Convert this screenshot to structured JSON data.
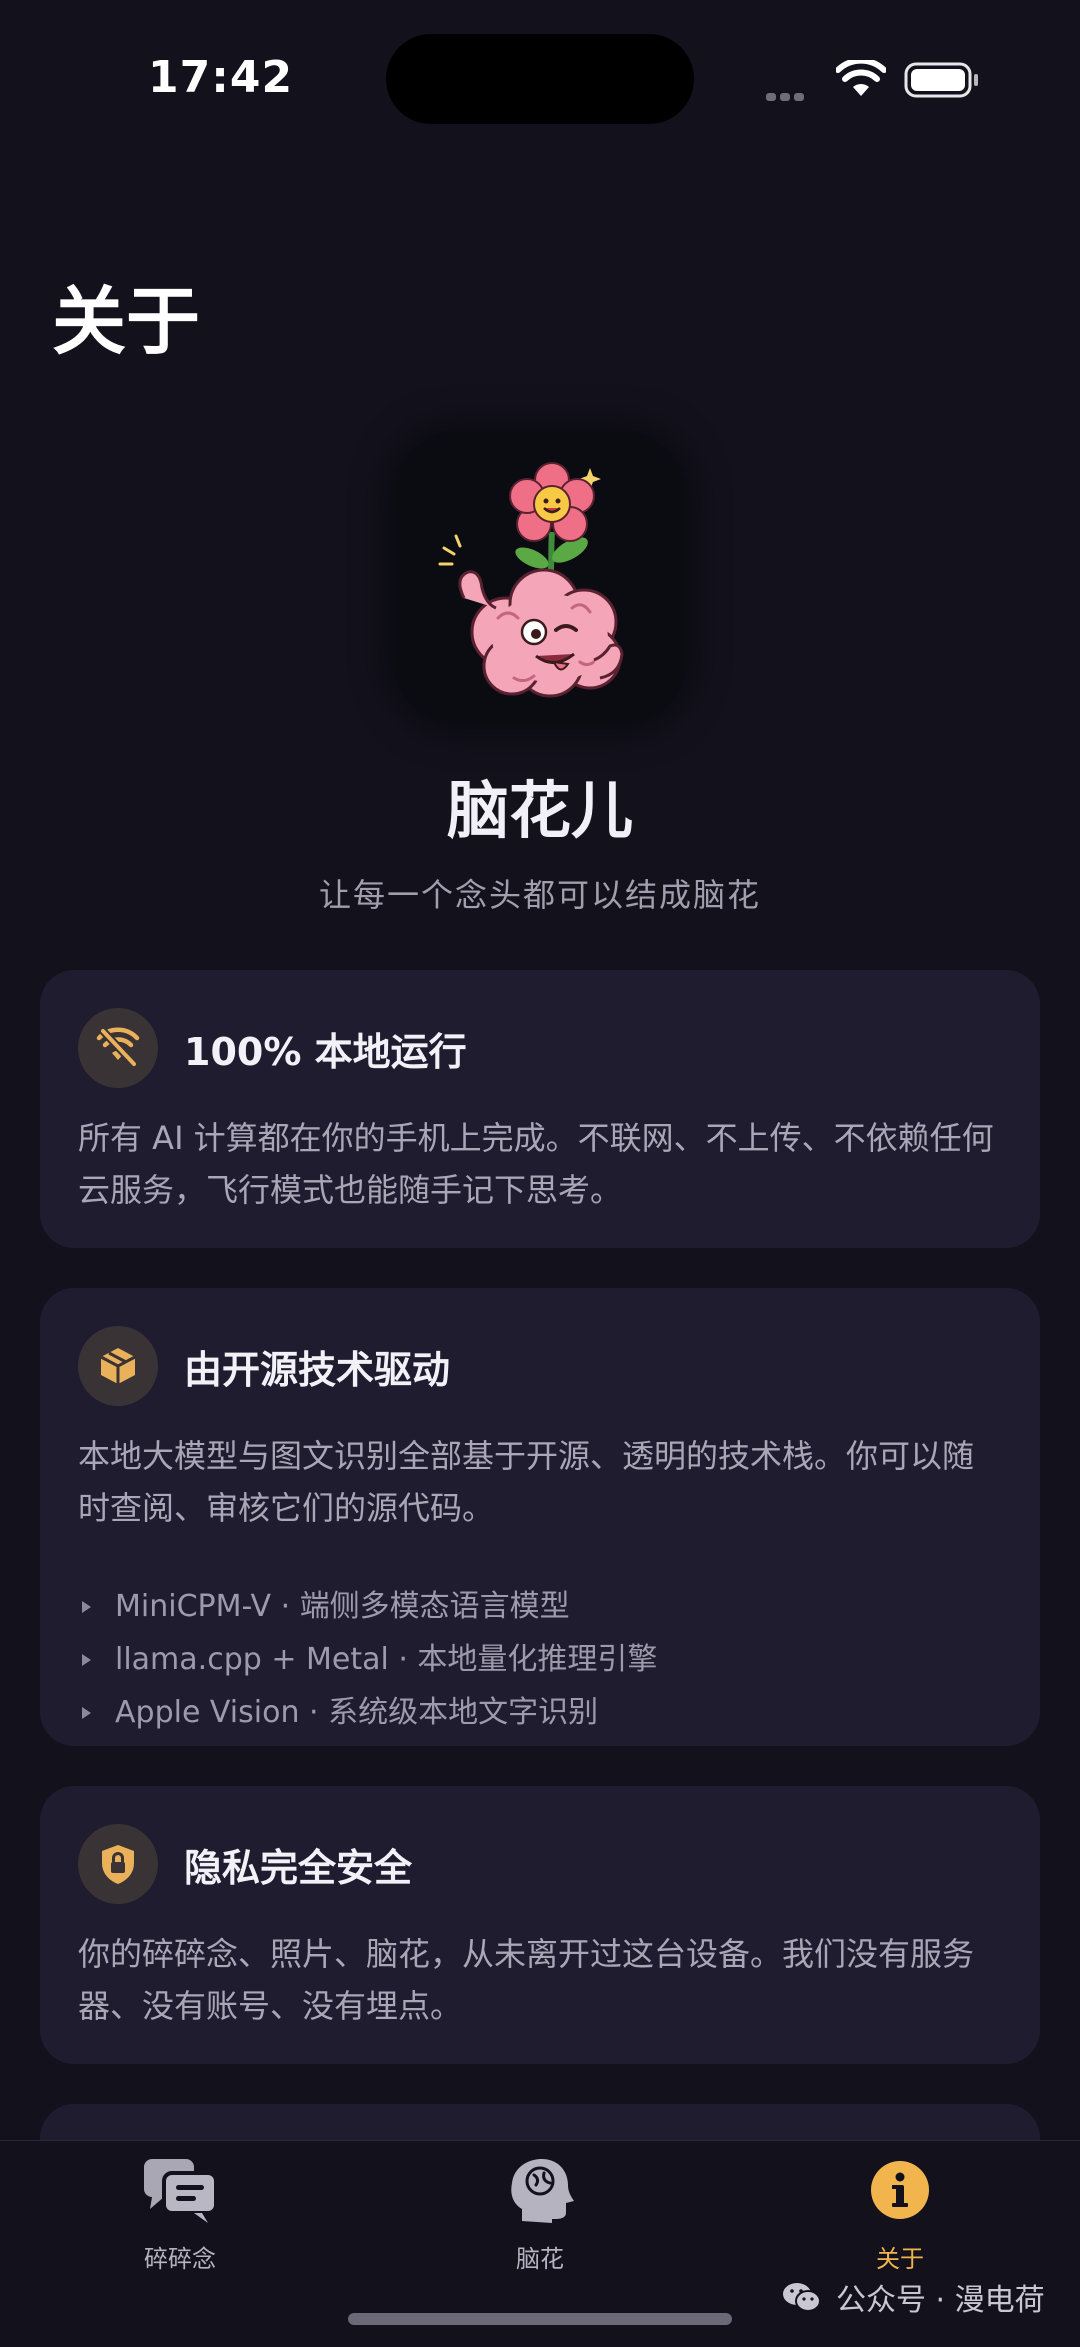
{
  "status_bar": {
    "time": "17:42"
  },
  "page": {
    "title": "关于"
  },
  "app": {
    "name": "脑花儿",
    "slogan": "让每一个念头都可以结成脑花"
  },
  "cards": [
    {
      "icon": "wifi-off-icon",
      "title": "100% 本地运行",
      "body": "所有 AI 计算都在你的手机上完成。不联网、不上传、不依赖任何云服务，飞行模式也能随手记下思考。"
    },
    {
      "icon": "open-box-icon",
      "title": "由开源技术驱动",
      "body": "本地大模型与图文识别全部基于开源、透明的技术栈。你可以随时查阅、审核它们的源代码。",
      "items": [
        "MiniCPM-V · 端侧多模态语言模型",
        "llama.cpp + Metal · 本地量化推理引擎",
        "Apple Vision · 系统级本地文字识别"
      ]
    },
    {
      "icon": "lock-shield-icon",
      "title": "隐私完全安全",
      "body": "你的碎碎念、照片、脑花，从未离开过这台设备。我们没有服务器、没有账号、没有埋点。"
    }
  ],
  "tabs": [
    {
      "icon": "chat-bubbles-icon",
      "label": "碎碎念"
    },
    {
      "icon": "brain-head-icon",
      "label": "脑花"
    },
    {
      "icon": "info-icon",
      "label": "关于",
      "active": true
    }
  ],
  "watermark": {
    "text": "公众号 · 漫电荷"
  },
  "colors": {
    "background": "#12111c",
    "card": "#1e1c2e",
    "accent": "#f2b54e"
  }
}
